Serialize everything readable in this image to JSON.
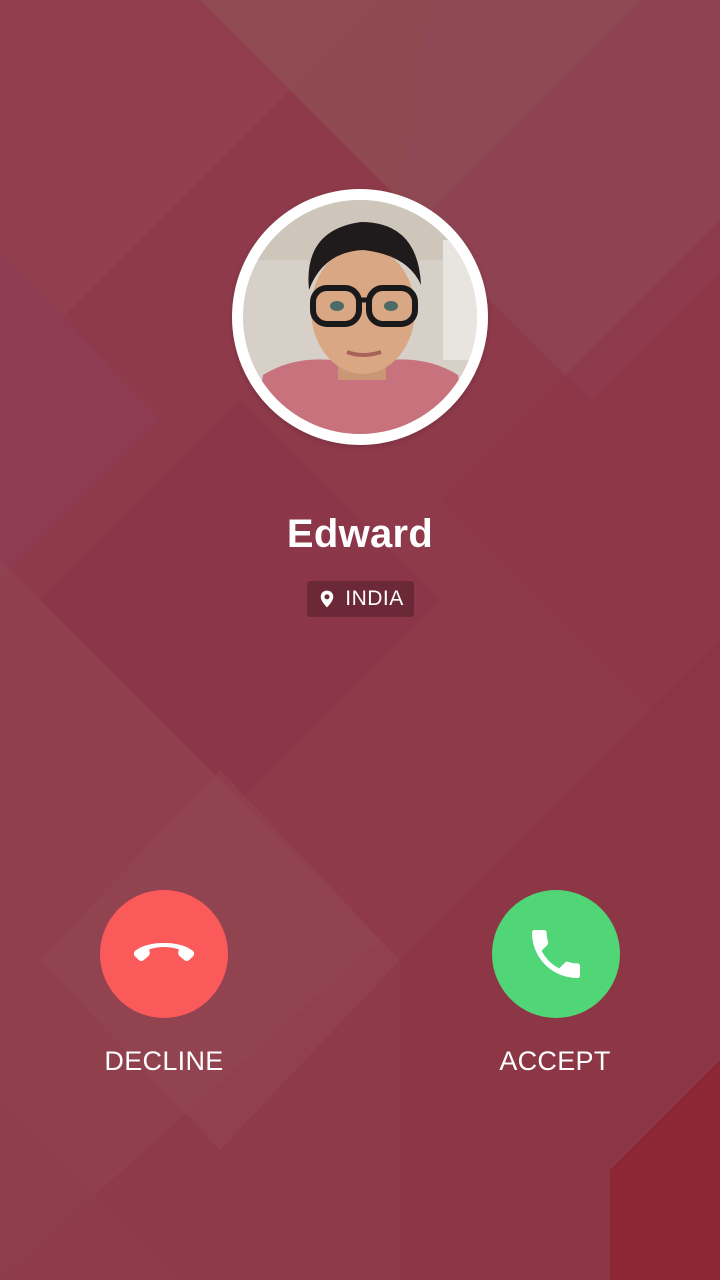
{
  "caller": {
    "name": "Edward",
    "location": "INDIA"
  },
  "actions": {
    "decline_label": "DECLINE",
    "accept_label": "ACCEPT"
  },
  "icons": {
    "location": "map-pin-icon",
    "decline": "phone-hangup-icon",
    "accept": "phone-icon"
  },
  "colors": {
    "background": "#8e3a4a",
    "decline": "#fb5a5b",
    "accept": "#50d676",
    "text": "#ffffff"
  }
}
